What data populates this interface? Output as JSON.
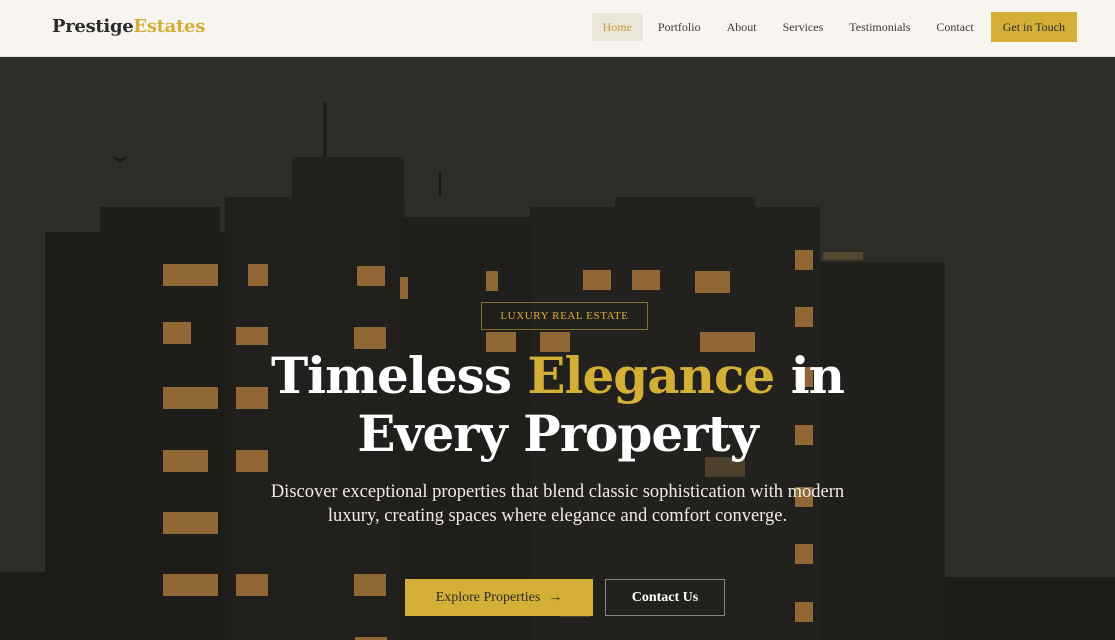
{
  "brand": {
    "name_part1": "Prestige",
    "name_part2": "Estates",
    "accent_color": "#d4af37"
  },
  "nav": {
    "links": [
      "Home",
      "Portfolio",
      "About",
      "Services",
      "Testimonials",
      "Contact"
    ],
    "active": "Home",
    "cta_label": "Get in Touch"
  },
  "hero": {
    "badge": "LUXURY REAL ESTATE",
    "headline_part1": "Timeless ",
    "headline_accent": "Elegance",
    "headline_part2": " in",
    "headline_line2": "Every Property",
    "subtitle": "Discover exceptional properties that blend classic sophistication with modern luxury, creating spaces where elegance and comfort converge.",
    "primary_button": "Explore Properties",
    "primary_icon": "arrow-right-icon",
    "secondary_button": "Contact Us"
  }
}
